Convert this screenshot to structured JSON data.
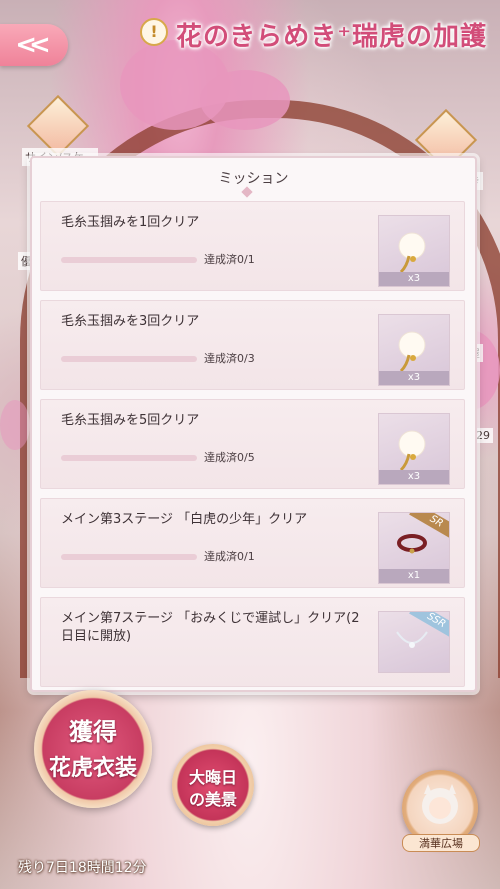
{
  "header": {
    "back_label": "<<",
    "alert_icon": "exclamation-icon",
    "event_title": "花のきらめき⁺瑞虎の加護"
  },
  "side_labels": {
    "left_top": "サイン/スケ",
    "left_mid": "優",
    "right_top": "き",
    "right_mid": "屋",
    "right_count": "229"
  },
  "mission_panel": {
    "title": "ミッション",
    "missions": [
      {
        "name": "毛糸玉掴みを1回クリア",
        "progress_text": "達成済0/1",
        "progress": 0,
        "reward_icon": "yarn-pom-accessory-icon",
        "reward_count": "x3"
      },
      {
        "name": "毛糸玉掴みを3回クリア",
        "progress_text": "達成済0/3",
        "progress": 0,
        "reward_icon": "yarn-pom-accessory-icon",
        "reward_count": "x3"
      },
      {
        "name": "毛糸玉掴みを5回クリア",
        "progress_text": "達成済0/5",
        "progress": 0,
        "reward_icon": "yarn-pom-accessory-icon",
        "reward_count": "x3"
      },
      {
        "name": "メイン第3ステージ 「白虎の少年」クリア",
        "progress_text": "達成済0/1",
        "progress": 0,
        "reward_icon": "red-choker-icon",
        "reward_count": "x1",
        "rank": "SR"
      },
      {
        "name": "メイン第7ステージ 「おみくじで運試し」クリア(2日目に開放)",
        "progress_text": "",
        "progress": 0,
        "reward_icon": "necklace-icon",
        "reward_count": "",
        "rank": "SSR"
      }
    ]
  },
  "bottom": {
    "acquire_line1": "獲得",
    "acquire_line2": "花虎衣装",
    "nye_line1": "大晦日",
    "nye_line2": "の美景",
    "plaza_label": "満華広場",
    "remaining_time": "残り7日18時間12分"
  },
  "colors": {
    "accent_pink": "#d24d79",
    "panel_bg": "#fbf7f8",
    "progress_track": "#eacdd6"
  }
}
